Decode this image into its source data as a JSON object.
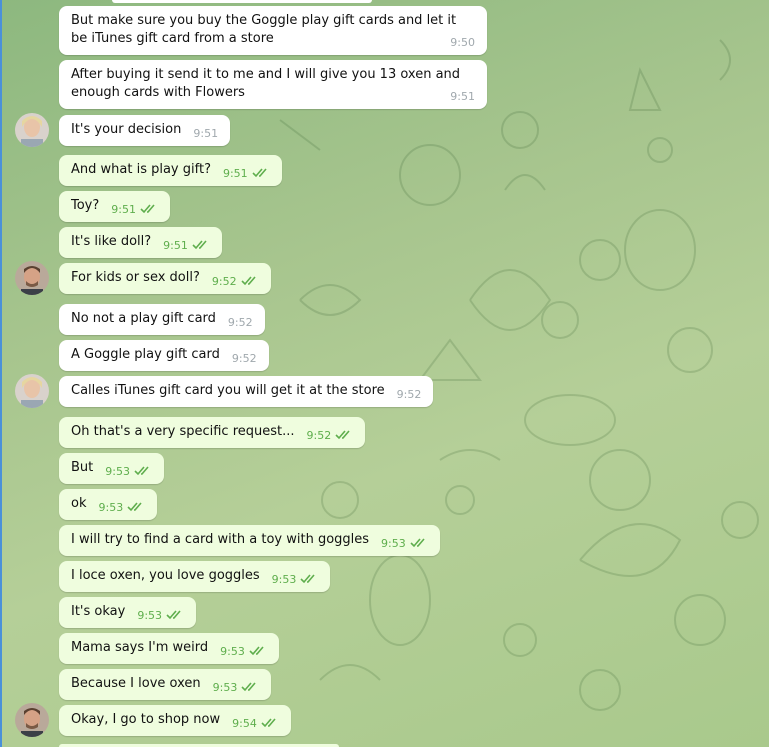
{
  "colors": {
    "incoming_bubble": "#ffffff",
    "outgoing_bubble": "#effdde",
    "read_ticks": "#5fae4d"
  },
  "messages": [
    {
      "dir": "in",
      "text": "But make sure you buy the Goggle play gift cards and let it be iTunes gift card from a store",
      "time": "9:50"
    },
    {
      "dir": "in",
      "text": "After buying it send it to me and I will give you 13 oxen and enough cards with Flowers",
      "time": "9:51"
    },
    {
      "dir": "in",
      "text": "It's your decision",
      "time": "9:51"
    },
    {
      "dir": "out",
      "text": "And what is play gift?",
      "time": "9:51"
    },
    {
      "dir": "out",
      "text": "Toy?",
      "time": "9:51"
    },
    {
      "dir": "out",
      "text": "It's like doll?",
      "time": "9:51"
    },
    {
      "dir": "out",
      "text": "For kids or sex doll?",
      "time": "9:52"
    },
    {
      "dir": "in",
      "text": "No not a play gift card",
      "time": "9:52"
    },
    {
      "dir": "in",
      "text": "A Goggle play gift card",
      "time": "9:52"
    },
    {
      "dir": "in",
      "text": "Calles iTunes gift card you will get it at the store",
      "time": "9:52"
    },
    {
      "dir": "out",
      "text": "Oh that's a very specific request...",
      "time": "9:52"
    },
    {
      "dir": "out",
      "text": "But",
      "time": "9:53"
    },
    {
      "dir": "out",
      "text": "ok",
      "time": "9:53"
    },
    {
      "dir": "out",
      "text": "I will try to find a card with a toy with goggles",
      "time": "9:53"
    },
    {
      "dir": "out",
      "text": "I loce oxen, you love goggles",
      "time": "9:53"
    },
    {
      "dir": "out",
      "text": "It's okay",
      "time": "9:53"
    },
    {
      "dir": "out",
      "text": "Mama says I'm weird",
      "time": "9:53"
    },
    {
      "dir": "out",
      "text": "Because I love oxen",
      "time": "9:53"
    },
    {
      "dir": "out",
      "text": "Okay, I go to shop now",
      "time": "9:54"
    }
  ]
}
